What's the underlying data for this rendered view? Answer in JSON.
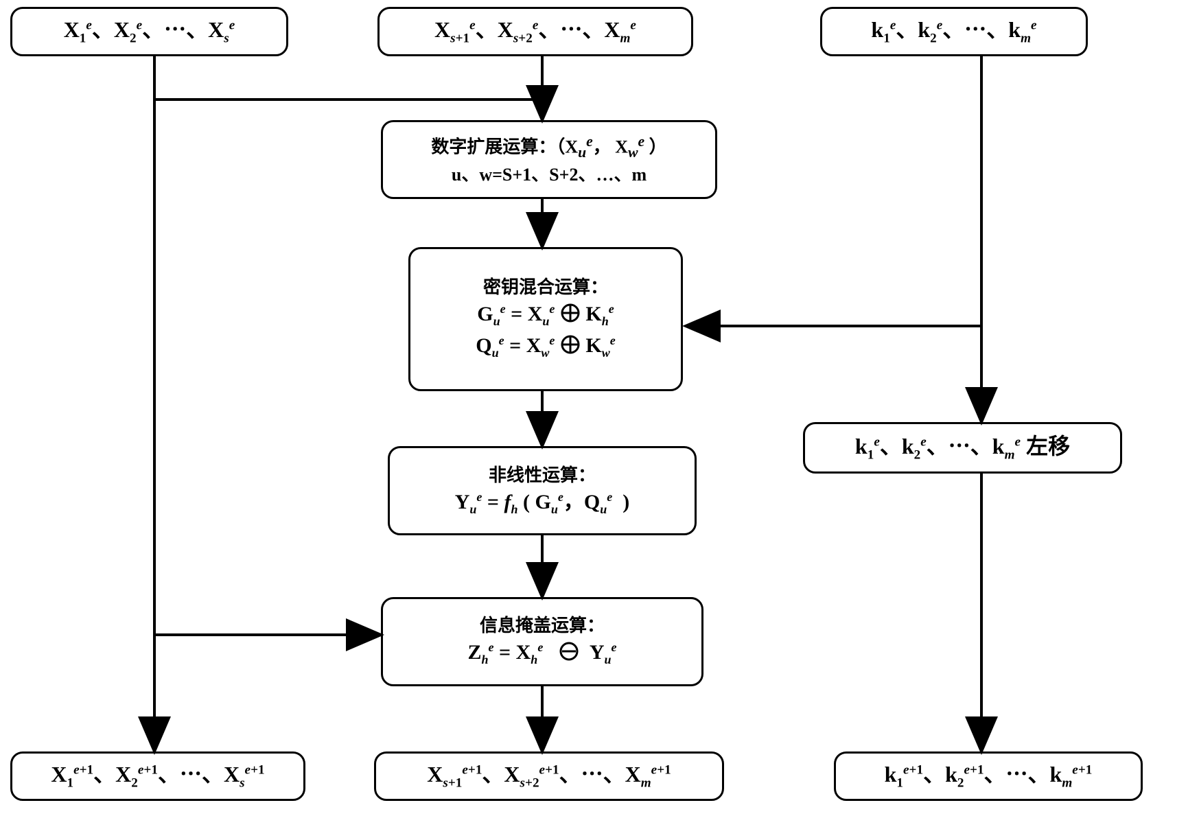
{
  "top": {
    "left_seq": "X₁ᵉ、X₂ᵉ、⋯、Xₛᵉ",
    "mid_seq": "Xₛ₊₁ᵉ、Xₛ₊₂ᵉ、⋯、Xₘᵉ",
    "right_seq": "k₁ᵉ、k₂ᵉ、⋯、kₘᵉ"
  },
  "expand": {
    "title": "数字扩展运算：（Xᵤᵉ，Xᵥᵥᵉ）",
    "sub": "u、w=S+1、S+2、…、m"
  },
  "keymix": {
    "title": "密钥混合运算：",
    "line1": "Gᵤᵉ = Xᵤᵉ ⊕ Kₕᵉ",
    "line2": "Qᵤᵉ = Xᵥᵥᵉ ⊕ Kᵥᵥᵉ"
  },
  "nonlinear": {
    "title": "非线性运算：",
    "line": "Yᵤᵉ = fₕ ( Gᵤᵉ，Qᵤᵉ )"
  },
  "mask": {
    "title": "信息掩盖运算：",
    "line": "Zₕᵉ = Xₕᵉ  ⊖  Yᵤᵉ"
  },
  "shift": {
    "text": "k₁ᵉ、k₂ᵉ、⋯、kₘᵉ 左移"
  },
  "bottom": {
    "left_seq": "X₁ᵉ⁺¹、X₂ᵉ⁺¹、⋯、Xₛᵉ⁺¹",
    "mid_seq": "Xₛ₊₁ᵉ⁺¹、Xₛ₊₂ᵉ⁺¹、⋯、Xₘᵉ⁺¹",
    "right_seq": "k₁ᵉ⁺¹、k₂ᵉ⁺¹、⋯、kₘᵉ⁺¹"
  },
  "chart_data": {
    "type": "flowchart",
    "nodes": [
      {
        "id": "in_left",
        "label": "X_1^e … X_s^e",
        "kind": "input"
      },
      {
        "id": "in_mid",
        "label": "X_{s+1}^e … X_m^e",
        "kind": "input"
      },
      {
        "id": "in_right",
        "label": "k_1^e … k_m^e",
        "kind": "input"
      },
      {
        "id": "expand",
        "label": "数字扩展运算 (X_u^e, X_w^e); u,w = S+1,S+2,…,m",
        "kind": "process"
      },
      {
        "id": "keymix",
        "label": "密钥混合运算: G_u^e = X_u^e ⊕ K_h^e; Q_u^e = X_w^e ⊕ K_w^e",
        "kind": "process"
      },
      {
        "id": "nonlinear",
        "label": "非线性运算: Y_u^e = f_h(G_u^e, Q_u^e)",
        "kind": "process"
      },
      {
        "id": "mask",
        "label": "信息掩盖运算: Z_h^e = X_h^e ⊖ Y_u^e",
        "kind": "process"
      },
      {
        "id": "shift",
        "label": "k_1^e … k_m^e 左移",
        "kind": "process"
      },
      {
        "id": "out_left",
        "label": "X_1^{e+1} … X_s^{e+1}",
        "kind": "output"
      },
      {
        "id": "out_mid",
        "label": "X_{s+1}^{e+1} … X_m^{e+1}",
        "kind": "output"
      },
      {
        "id": "out_right",
        "label": "k_1^{e+1} … k_m^{e+1}",
        "kind": "output"
      }
    ],
    "edges": [
      {
        "from": "in_mid",
        "to": "expand"
      },
      {
        "from": "expand",
        "to": "keymix"
      },
      {
        "from": "in_right",
        "to": "keymix"
      },
      {
        "from": "in_right",
        "to": "shift"
      },
      {
        "from": "keymix",
        "to": "nonlinear"
      },
      {
        "from": "nonlinear",
        "to": "mask"
      },
      {
        "from": "in_left",
        "to": "mask"
      },
      {
        "from": "in_left",
        "to": "out_left",
        "note": "pass-through branch"
      },
      {
        "from": "mask",
        "to": "out_mid"
      },
      {
        "from": "shift",
        "to": "out_right"
      }
    ]
  }
}
